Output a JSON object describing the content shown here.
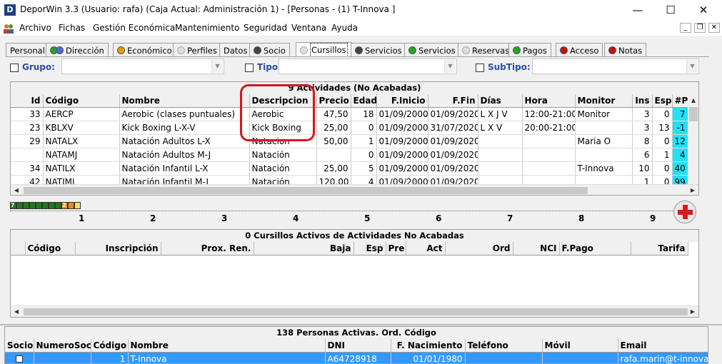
{
  "window": {
    "app_icon": "D",
    "title": "DeporWin 3.3  (Usuario: rafa)  (Caja Actual: Administración 1) - [Personas - (1) T-Innova ]",
    "minimize": "—",
    "maximize": "☐",
    "close": "✕"
  },
  "menu": [
    "Archivo",
    "Fichas",
    "Gestión Económica",
    "Mantenimiento",
    "Seguridad",
    "Ventana",
    "Ayuda"
  ],
  "tabs": [
    "Personal",
    "Dirección",
    "Económico",
    "Perfiles",
    "Datos",
    "Socio",
    "Cursillos",
    "Servicios",
    "Servicios",
    "Reservas",
    "Pagos",
    "Acceso",
    "Notas"
  ],
  "filters": {
    "grupo": "Grupo:",
    "tipo": "Tipo:",
    "subtipo": "SubTipo:"
  },
  "activities": {
    "caption": "9 Actividades  (No Acabadas)",
    "columns": [
      "Id",
      "Código",
      "Nombre",
      "Descripcion",
      "Precio",
      "Edad",
      "F.Inicio",
      "F.Fin",
      "Días",
      "Hora",
      "Monitor",
      "Ins",
      "Esp",
      "#P"
    ],
    "rows": [
      [
        "33",
        "AERCP",
        "Aerobic (clases puntuales)",
        "Aerobic",
        "47,50",
        "18",
        "01/09/2000",
        "01/09/2020",
        "L X J V",
        "12:00-21:00",
        "Monitor",
        "3",
        "0",
        "7"
      ],
      [
        "23",
        "KBLXV",
        "Kick Boxing  L-X-V",
        "Kick Boxing",
        "25,00",
        "0",
        "01/09/2000",
        "31/07/2020",
        "L X V",
        "20:00-21:00",
        "",
        "3",
        "13",
        "-1"
      ],
      [
        "29",
        "NATALX",
        "Natación Adultos L-X",
        "Natacion",
        "50,00",
        "1",
        "01/09/2000",
        "01/09/2020",
        "",
        "",
        "Maria O",
        "8",
        "0",
        "12"
      ],
      [
        "",
        "NATAMJ",
        "Natación Adultos M-J",
        "Natación",
        "",
        "0",
        "01/09/2000",
        "01/09/2020",
        "",
        "",
        "",
        "6",
        "1",
        "4"
      ],
      [
        "34",
        "NATILX",
        "Natación Infantil L-X",
        "Natación",
        "25,00",
        "5",
        "01/09/2000",
        "01/09/2020",
        "",
        "",
        "T-Innova",
        "10",
        "0",
        "40"
      ],
      [
        "42",
        "NATIMJ",
        "Natación Infantil M-J",
        "Natación",
        "120,00",
        "4",
        "01/09/2000",
        "01/09/2020",
        "",
        "",
        "",
        "1",
        "0",
        "99"
      ]
    ]
  },
  "ruler": {
    "green_label": "7",
    "orange_label": "2",
    "numbers": [
      "1",
      "2",
      "3",
      "4",
      "5",
      "6",
      "7",
      "8",
      "9"
    ]
  },
  "courses": {
    "caption": "0 Cursillos Activos de Actividades No Acabadas",
    "columns": [
      "Código",
      "Inscripción",
      "Prox. Ren.",
      "Baja",
      "Esp",
      "Pre",
      "Act",
      "Ord",
      "NCI",
      "F.Pago",
      "Tarifa"
    ]
  },
  "persons": {
    "caption": "138 Personas Activas. Ord. Código",
    "columns": [
      "Socio",
      "NumeroSocio",
      "Código",
      "Nombre",
      "DNI",
      "F. Nacimiento",
      "Teléfono",
      "Móvil",
      "Email"
    ],
    "rows": [
      [
        "",
        "",
        "1",
        "T-Innova",
        "A64728918",
        "01/01/1980",
        "",
        "",
        "rafa.marin@t-innova"
      ]
    ]
  },
  "colors": {
    "highlight": "#21e1f7",
    "annotation": "#d8141c",
    "selection": "#3399ff"
  }
}
